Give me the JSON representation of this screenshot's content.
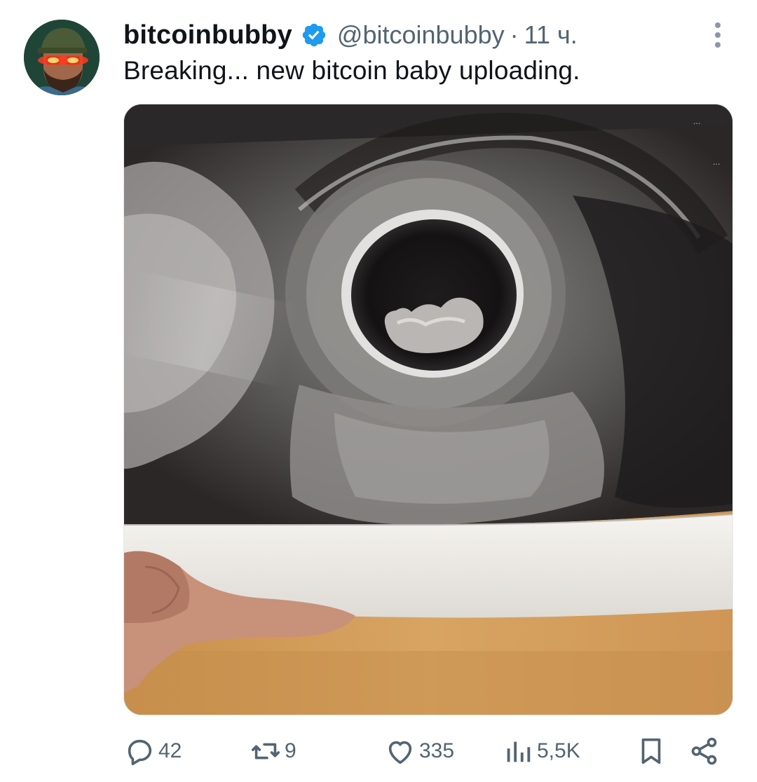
{
  "post": {
    "display_name": "bitcoinbubby",
    "handle": "@bitcoinbubby",
    "separator": "·",
    "time": "11 ч.",
    "text": "Breaking... new bitcoin baby uploading.",
    "verified": true
  },
  "icons": {
    "avatar": "laser-eyes-avatar",
    "verified": "verified-badge-icon",
    "more": "more-vertical-icon",
    "reply": "reply-icon",
    "repost": "repost-icon",
    "like": "heart-icon",
    "views": "views-icon",
    "bookmark": "bookmark-icon",
    "share": "share-icon"
  },
  "media": {
    "kind": "ultrasound-photo",
    "overlay_text_top_right": "...",
    "overlay_text_right": "..."
  },
  "actions": {
    "reply_count": "42",
    "repost_count": "9",
    "like_count": "335",
    "view_count": "5,5K"
  },
  "colors": {
    "text_primary": "#0f1419",
    "text_secondary": "#536471",
    "verified_blue": "#1d9bf0",
    "background": "#ffffff"
  }
}
